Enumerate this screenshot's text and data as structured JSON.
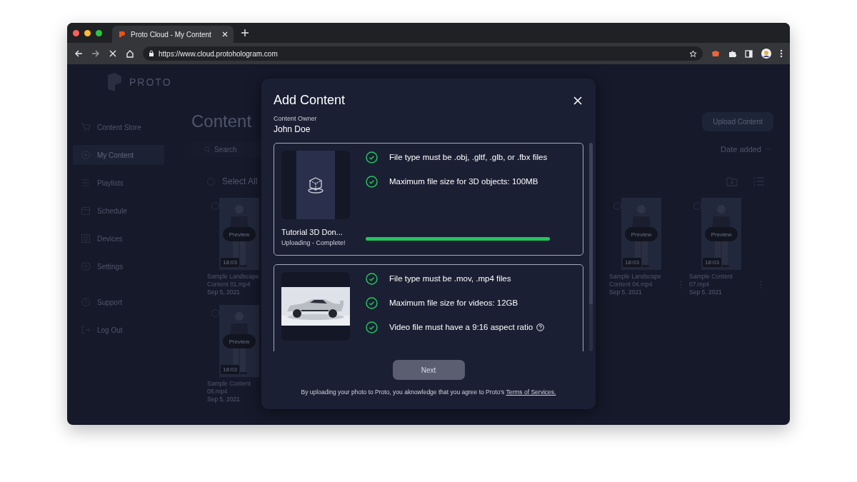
{
  "browser": {
    "tab_title": "Proto Cloud - My Content",
    "url": "https://www.cloud.protohologram.com",
    "loading": true
  },
  "app": {
    "logo": "PROTO",
    "sidebar": {
      "items": [
        {
          "label": "Content Store",
          "selected": false
        },
        {
          "label": "My Content",
          "selected": true
        },
        {
          "label": "Playlists",
          "selected": false
        },
        {
          "label": "Schedule",
          "selected": false
        },
        {
          "label": "Devices",
          "selected": false
        },
        {
          "label": "Settings",
          "selected": false
        }
      ],
      "bottom_items": [
        {
          "label": "Support",
          "selected": false
        },
        {
          "label": "Log Out",
          "selected": false
        }
      ]
    },
    "main": {
      "title": "Content",
      "search": {
        "placeholder": "Search"
      },
      "upload_button": "Upload Content",
      "sort": "Date added",
      "select_all": {
        "label": "Select All",
        "checked": false
      },
      "left_cards": [
        {
          "name": "Sample Landscape Content 01.mp4",
          "date": "Sep 5, 2021",
          "duration": "18:03",
          "preview": "Preview",
          "checked": false
        },
        {
          "name": "Sample Content 08.mp4",
          "date": "Sep 5, 2021",
          "duration": "18:03",
          "preview": "Preview",
          "checked": false
        }
      ],
      "right_cards": [
        {
          "name": "Sample Landscape Content 04.mp4",
          "date": "Sep 5, 2021",
          "duration": "18:03",
          "preview": "Preview",
          "checked": false
        },
        {
          "name": "Sample Content 07.mp4",
          "date": "Sep 5, 2021",
          "duration": "18:03",
          "preview": "Preview",
          "checked": false
        }
      ]
    }
  },
  "modal": {
    "title": "Add Content",
    "owner_label": "Content Owner",
    "owner": "John Doe",
    "uploads": [
      {
        "kind": "model",
        "name": "Tutorial 3D Don...",
        "status": "Uploading - Complete!",
        "level": 1,
        "checks": [
          {
            "text": "File type must be .obj, .gltf, .glb, or .fbx files",
            "passed": true,
            "help": false
          },
          {
            "text": "Maximum file size for 3D objects: 100MB",
            "passed": true,
            "help": false
          }
        ]
      },
      {
        "kind": "video",
        "checks": [
          {
            "text": "File type must be .mov, .mp4 files",
            "passed": true,
            "help": false
          },
          {
            "text": "Maximum file size for videos: 12GB",
            "passed": true,
            "help": false
          },
          {
            "text": "Video file must have a 9:16 aspect ratio",
            "passed": true,
            "help": true
          }
        ]
      }
    ],
    "next_button": {
      "label": "Next",
      "disabled": true
    },
    "footer": {
      "text": "By uploading your photo to Proto, you aknowledge that you agree to Proto's",
      "link": "Terms of Services."
    }
  }
}
